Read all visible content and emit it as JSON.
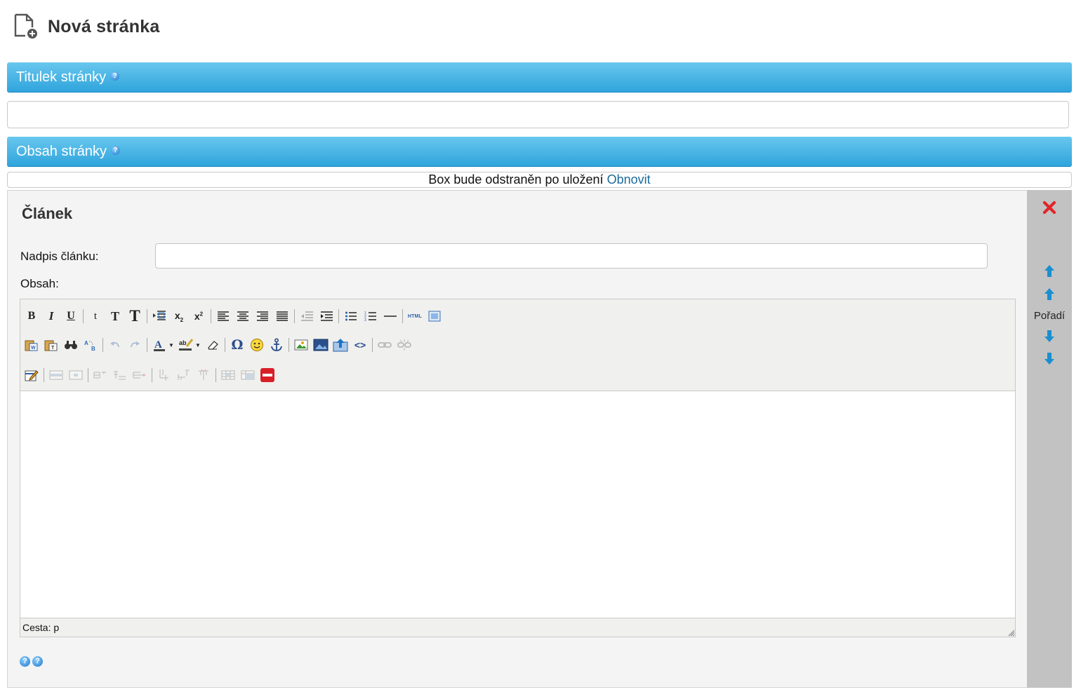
{
  "page": {
    "title": "Nová stránka",
    "icon": "new-page-icon"
  },
  "sections": {
    "title_section": {
      "label": "Titulek stránky",
      "help_glyph": "?"
    },
    "content_section": {
      "label": "Obsah stránky",
      "help_glyph": "?"
    }
  },
  "title_field": {
    "value": "",
    "placeholder": ""
  },
  "notice": {
    "text": "Box bude odstraněn po uložení",
    "link": "Obnovit"
  },
  "article": {
    "title": "Článek",
    "heading_label": "Nadpis článku:",
    "heading_value": "",
    "content_label": "Obsah:"
  },
  "editor": {
    "status_path": "Cesta: p",
    "toolbar_rows": [
      [
        "bold",
        "italic",
        "underline",
        "|",
        "font-small",
        "font-medium",
        "font-large",
        "|",
        "indent-block",
        "subscript",
        "superscript",
        "|",
        "align-left",
        "align-center",
        "align-right",
        "align-justify",
        "|",
        "outdent",
        "indent",
        "|",
        "bullet-list",
        "numbered-list",
        "horizontal-rule",
        "|",
        "html-source",
        "preview"
      ],
      [
        "paste-word",
        "paste-text",
        "find",
        "replace",
        "|",
        "undo",
        "redo",
        "|",
        "text-color",
        "highlight-color",
        "eraser",
        "|",
        "special-char",
        "emoticon",
        "anchor",
        "|",
        "insert-image",
        "insert-media",
        "upload-image",
        "code",
        "|",
        "link",
        "unlink"
      ],
      [
        "edit-table",
        "|",
        "table-row-props",
        "table-cell-props",
        "|",
        "row-insert",
        "row-after",
        "row-delete",
        "|",
        "col-before",
        "col-after",
        "col-delete",
        "|",
        "merge-cells",
        "split-cells",
        "delete-box"
      ]
    ]
  },
  "side": {
    "order_label": "Pořadí",
    "icons": [
      "close-icon",
      "move-top-icon",
      "move-up-icon",
      "move-down-icon",
      "move-bottom-icon"
    ]
  },
  "help_icons": [
    "?",
    "?"
  ],
  "colors": {
    "section_bar_top": "#68c7ee",
    "section_bar_bottom": "#2fa4dc",
    "link": "#1b6b9c",
    "close": "#e0262a",
    "arrow": "#1a8fcf"
  }
}
